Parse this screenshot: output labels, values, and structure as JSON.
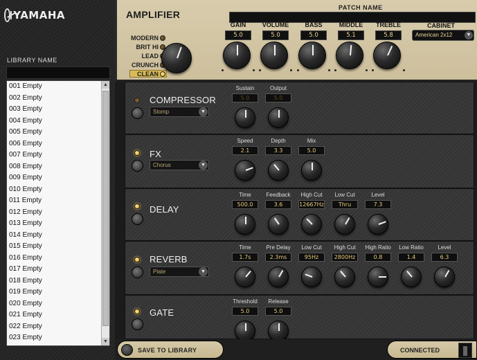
{
  "brand": "YAMAHA",
  "library": {
    "title": "LIBRARY NAME",
    "items": [
      "001 Empty",
      "002 Empty",
      "003 Empty",
      "004 Empty",
      "005 Empty",
      "006 Empty",
      "007 Empty",
      "008 Empty",
      "009 Empty",
      "010 Empty",
      "011 Empty",
      "012 Empty",
      "013 Empty",
      "014 Empty",
      "015 Empty",
      "016 Empty",
      "017 Empty",
      "018 Empty",
      "019 Empty",
      "020 Empty",
      "021 Empty",
      "022 Empty",
      "023 Empty"
    ]
  },
  "amp": {
    "title": "AMPLIFIER",
    "patch_label": "PATCH NAME",
    "modes": [
      "MODERN",
      "BRIT HI",
      "LEAD",
      "CRUNCH",
      "CLEAN"
    ],
    "selected_mode": "CLEAN",
    "knobs": [
      {
        "label": "GAIN",
        "value": "5.0"
      },
      {
        "label": "VOLUME",
        "value": "5.0"
      },
      {
        "label": "BASS",
        "value": "5.0"
      },
      {
        "label": "MIDDLE",
        "value": "5.1"
      },
      {
        "label": "TREBLE",
        "value": "5.8"
      }
    ],
    "cabinet_label": "CABINET",
    "cabinet_value": "American 2x12"
  },
  "effects": {
    "compressor": {
      "title": "COMPRESSOR",
      "type": "Stomp",
      "enabled": false,
      "params": [
        {
          "label": "Sustain",
          "value": "5.0"
        },
        {
          "label": "Output",
          "value": "5.0"
        }
      ]
    },
    "fx": {
      "title": "FX",
      "type": "Chorus",
      "enabled": true,
      "params": [
        {
          "label": "Speed",
          "value": "2.1"
        },
        {
          "label": "Depth",
          "value": "3.3"
        },
        {
          "label": "Mix",
          "value": "5.0"
        }
      ]
    },
    "delay": {
      "title": "DELAY",
      "enabled": true,
      "params": [
        {
          "label": "Time",
          "value": "500.0"
        },
        {
          "label": "Feedback",
          "value": "3.6"
        },
        {
          "label": "High Cut",
          "value": "12667Hz"
        },
        {
          "label": "Low Cut",
          "value": "Thru"
        },
        {
          "label": "Level",
          "value": "7.3"
        }
      ]
    },
    "reverb": {
      "title": "REVERB",
      "type": "Plate",
      "enabled": true,
      "params": [
        {
          "label": "Time",
          "value": "1.7s"
        },
        {
          "label": "Pre Delay",
          "value": "2.3ms"
        },
        {
          "label": "Low Cut",
          "value": "95Hz"
        },
        {
          "label": "High Cut",
          "value": "2800Hz"
        },
        {
          "label": "High Ratio",
          "value": "0.8"
        },
        {
          "label": "Low Ratio",
          "value": "1.4"
        },
        {
          "label": "Level",
          "value": "6.3"
        }
      ]
    },
    "gate": {
      "title": "GATE",
      "enabled": true,
      "params": [
        {
          "label": "Threshold",
          "value": "5.0"
        },
        {
          "label": "Release",
          "value": "5.0"
        }
      ]
    }
  },
  "footer": {
    "save_label": "SAVE TO LIBRARY",
    "status": "CONNECTED"
  },
  "colors": {
    "amp_panel": "#d8ccad",
    "value_text": "#e8cc7a",
    "led_on": "#ffd35a"
  }
}
